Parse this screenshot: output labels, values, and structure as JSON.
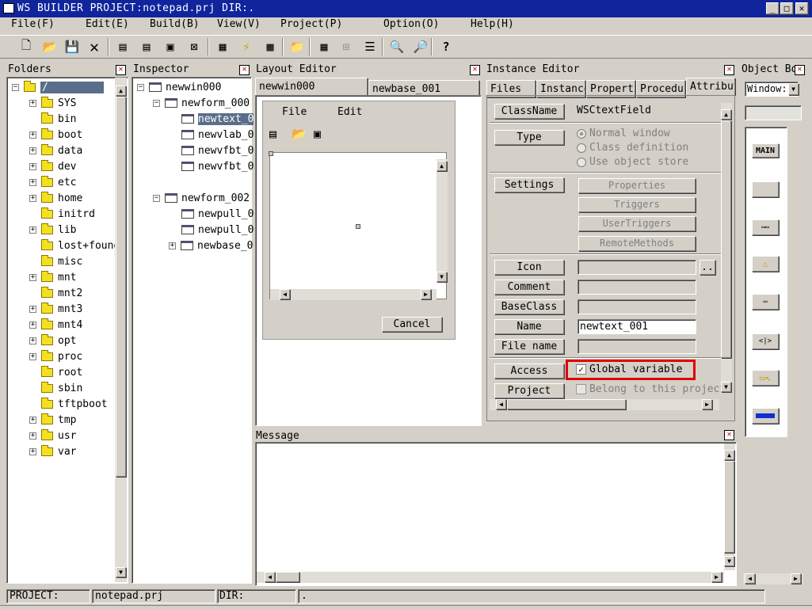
{
  "window": {
    "title": "WS BUILDER PROJECT:notepad.prj DIR:."
  },
  "menu": [
    "File(F)",
    "Edit(E)",
    "Build(B)",
    "View(V)",
    "Project(P)",
    "Option(O)",
    "Help(H)"
  ],
  "panes": {
    "folders": "Folders",
    "inspector": "Inspector",
    "layout": "Layout Editor",
    "instance": "Instance Editor",
    "objectbox": "Object Bo",
    "message": "Message"
  },
  "folders": {
    "root": "/",
    "items": [
      "SYS",
      "bin",
      "boot",
      "data",
      "dev",
      "etc",
      "home",
      "initrd",
      "lib",
      "lost+found",
      "misc",
      "mnt",
      "mnt2",
      "mnt3",
      "mnt4",
      "opt",
      "proc",
      "root",
      "sbin",
      "tftpboot",
      "tmp",
      "usr",
      "var"
    ]
  },
  "inspector": {
    "root": "newwin000",
    "form1": "newform_000",
    "form1_items": [
      "newtext_0",
      "newvlab_0",
      "newvfbt_0",
      "newvfbt_0"
    ],
    "form2": "newform_002",
    "form2_items": [
      "newpull_0",
      "newpull_0",
      "newbase_0"
    ]
  },
  "layout": {
    "tabs": [
      "newwin000",
      "newbase_001"
    ],
    "menu": [
      "File",
      "Edit"
    ],
    "cancel": "Cancel"
  },
  "instance": {
    "tabs": [
      "Files",
      "Instance",
      "Properti",
      "Procedur",
      "Attribut"
    ],
    "classname_label": "ClassName",
    "classname_value": "WSCtextField",
    "type_label": "Type",
    "type_options": [
      "Normal window",
      "Class definition",
      "Use object store"
    ],
    "settings_label": "Settings",
    "settings_buttons": [
      "Properties",
      "Triggers",
      "UserTriggers",
      "RemoteMethods"
    ],
    "icon_label": "Icon",
    "icon_browse": "..",
    "comment_label": "Comment",
    "baseclass_label": "BaseClass",
    "name_label": "Name",
    "name_value": "newtext_001",
    "filename_label": "File name",
    "access_label": "Access",
    "global_variable": "Global variable",
    "project_label": "Project",
    "belong_project": "Belong to this project"
  },
  "objectbox": {
    "select": "Window:",
    "main_label": "MAIN"
  },
  "status": {
    "project_label": "PROJECT:",
    "project_value": "notepad.prj",
    "dir_label": "DIR:",
    "dir_value": "."
  },
  "colors": {
    "titlebar": "#10249c",
    "highlight": "#e00000",
    "selection": "#5a6e8a"
  }
}
